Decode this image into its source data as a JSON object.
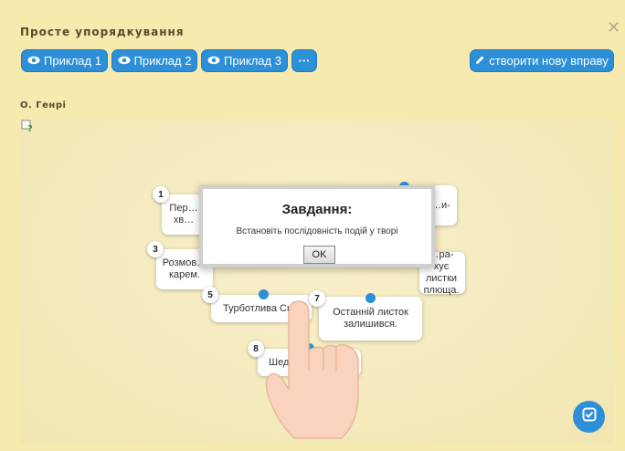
{
  "header": {
    "title": "Просте упорядкування"
  },
  "toolbar": {
    "example_buttons": [
      "Приклад 1",
      "Приклад 2",
      "Приклад 3"
    ],
    "more_label": "···",
    "create_label": "створити нову вправу"
  },
  "author": "О. Генрі",
  "cards": [
    {
      "num": "1",
      "text": "Пер… хв…"
    },
    {
      "num": "3",
      "text": "Розмов… карем."
    },
    {
      "num": "5",
      "text": "Турботлива Сью"
    },
    {
      "num": "7",
      "text": "Останній листок залишився."
    },
    {
      "num": "8",
      "text": "Шед…"
    },
    {
      "num": "",
      "text": "…и-"
    },
    {
      "num": "",
      "text": "…ра- хує листки плюща."
    }
  ],
  "modal": {
    "title": "Завдання:",
    "text": "Встановіть послідовність подій у творі",
    "ok_label": "OK"
  },
  "icons": {
    "eye": "eye-icon",
    "pencil": "pencil-icon",
    "close": "close-icon",
    "check": "check-icon",
    "help": "help-icon",
    "hand": "hand-pointer-icon"
  },
  "colors": {
    "accent": "#2d8fd8",
    "background": "#f6eaae"
  }
}
